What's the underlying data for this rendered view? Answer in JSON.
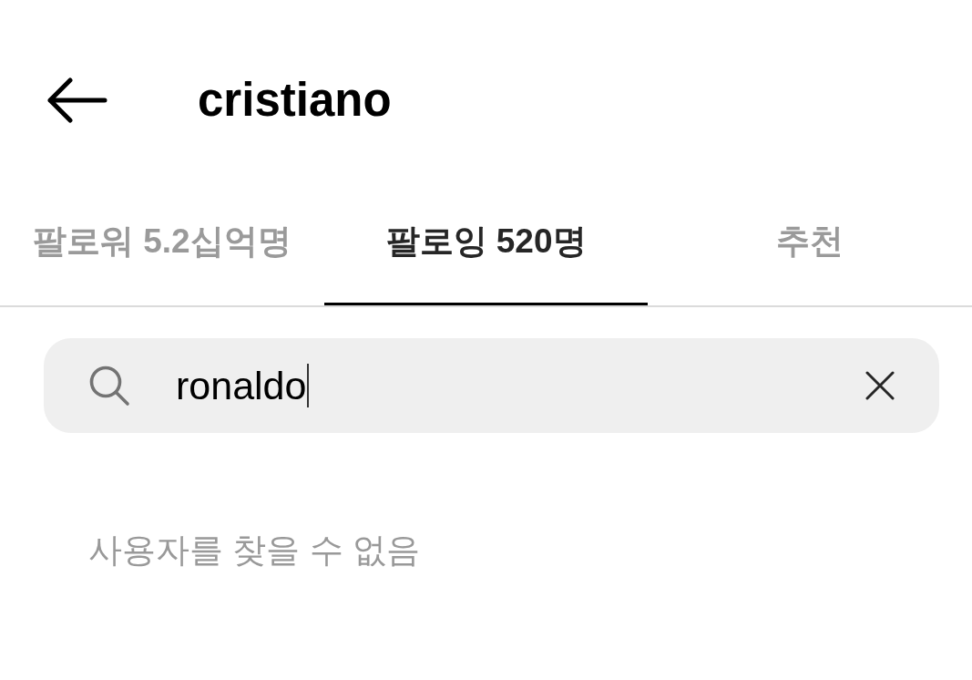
{
  "header": {
    "title": "cristiano"
  },
  "tabs": [
    {
      "label": "팔로워 5.2십억명",
      "selected": false
    },
    {
      "label": "팔로잉 520명",
      "selected": true
    },
    {
      "label": "추천",
      "selected": false
    }
  ],
  "search": {
    "value": "ronaldo",
    "focused": true
  },
  "empty_message": "사용자를 찾을 수 없음"
}
